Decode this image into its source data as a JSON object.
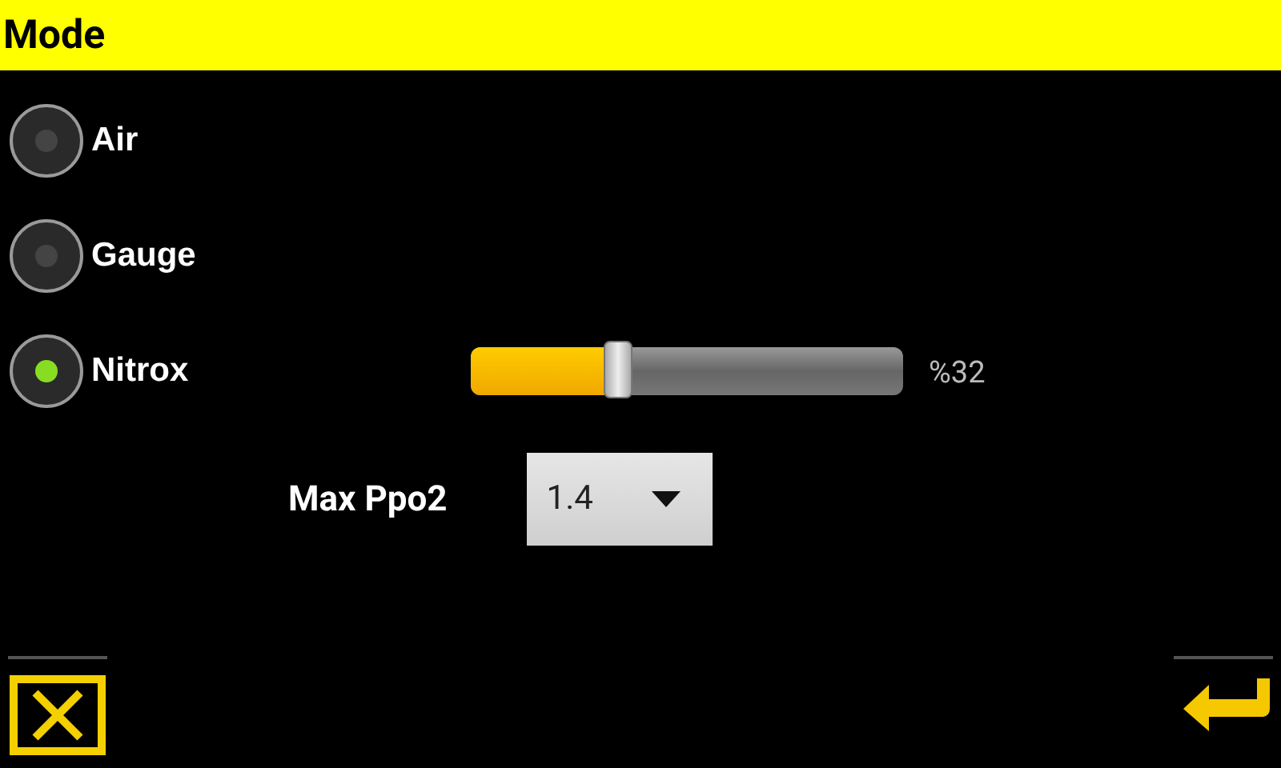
{
  "header": {
    "title": "Mode"
  },
  "modes": [
    {
      "label": "Air",
      "selected": false
    },
    {
      "label": "Gauge",
      "selected": false
    },
    {
      "label": "Nitrox",
      "selected": true
    }
  ],
  "oxygen_slider": {
    "level": 0.34,
    "reading": "%32"
  },
  "max_ppo2": {
    "label": "Max Ppo2",
    "value": "1.4"
  }
}
